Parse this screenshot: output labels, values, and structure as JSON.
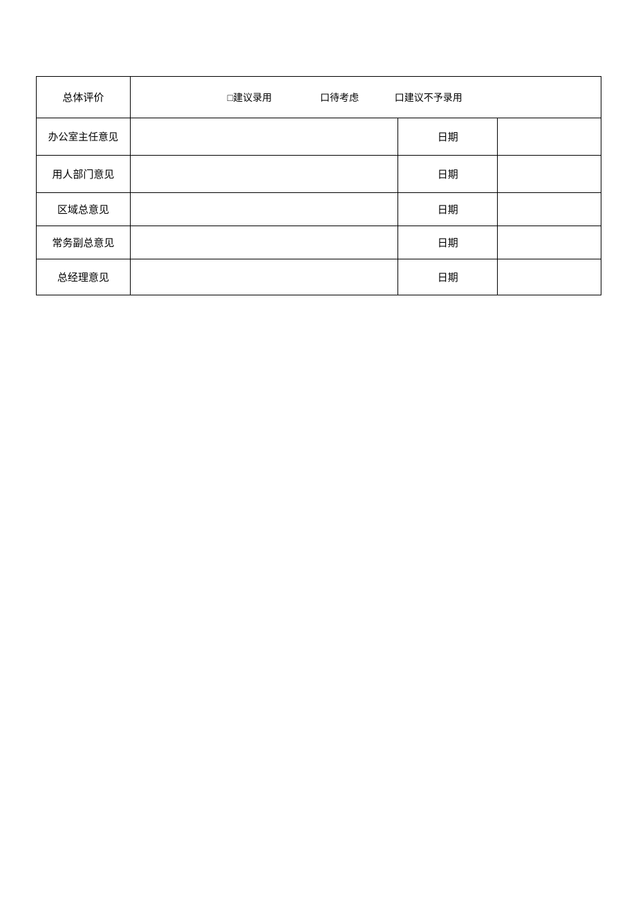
{
  "evaluation": {
    "label": "总体评价",
    "option1": "□建议录用",
    "option2": "口待考虑",
    "option3": "口建议不予录用"
  },
  "rows": [
    {
      "label": "办公室主任意见",
      "date_label": "日期"
    },
    {
      "label": "用人部门意见",
      "date_label": "日期"
    },
    {
      "label": "区域总意见",
      "date_label": "日期"
    },
    {
      "label": "常务副总意见",
      "date_label": "日期"
    },
    {
      "label": "总经理意见",
      "date_label": "日期"
    }
  ]
}
